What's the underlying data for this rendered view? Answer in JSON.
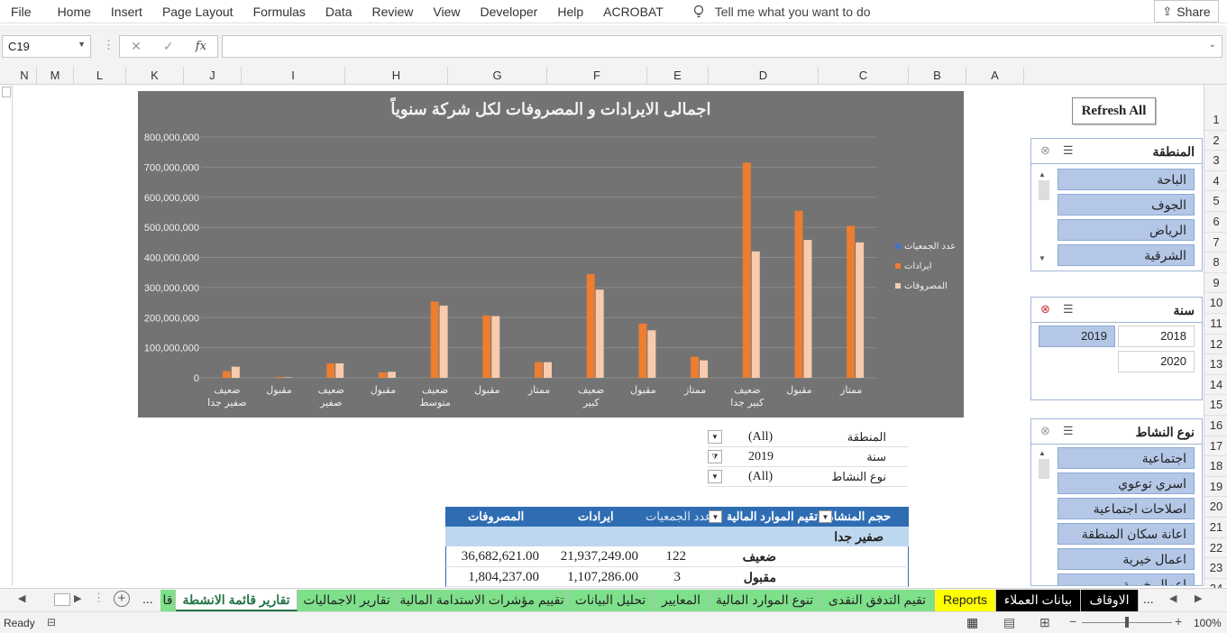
{
  "ribbon": {
    "tabs": [
      "File",
      "Home",
      "Insert",
      "Page Layout",
      "Formulas",
      "Data",
      "Review",
      "View",
      "Developer",
      "Help",
      "ACROBAT"
    ],
    "tell_me": "Tell me what you want to do",
    "share": "Share"
  },
  "formula_bar": {
    "name_box": "C19",
    "fx": "fx",
    "content": ""
  },
  "columns": [
    "N",
    "M",
    "L",
    "K",
    "J",
    "I",
    "H",
    "G",
    "F",
    "E",
    "D",
    "C",
    "B",
    "A"
  ],
  "rows": [
    "1",
    "2",
    "3",
    "4",
    "5",
    "6",
    "7",
    "8",
    "9",
    "10",
    "11",
    "12",
    "13",
    "14",
    "15",
    "16",
    "17",
    "18",
    "19",
    "20",
    "21",
    "22",
    "23",
    "24"
  ],
  "refresh_button": "Refresh All",
  "slicers": {
    "region": {
      "title": "المنطقة",
      "items": [
        "الباحة",
        "الجوف",
        "الرياض",
        "الشرقية"
      ]
    },
    "year": {
      "title": "سنة",
      "items": [
        {
          "label": "2019",
          "selected": true
        },
        {
          "label": "2018",
          "selected": false
        },
        {
          "label": "2020",
          "selected": false
        }
      ]
    },
    "activity": {
      "title": "نوع النشاط",
      "items": [
        "اجتماعية",
        "اسري توعوي",
        "اصلاحات اجتماعية",
        "اعانة سكان المنطقة",
        "اعمال خيرية",
        "اعمال خيرية"
      ]
    }
  },
  "filters": [
    {
      "label": "المنطقة",
      "value": "(All)"
    },
    {
      "label": "سنة",
      "value": "2019"
    },
    {
      "label": "نوع النشاط",
      "value": "(All)"
    }
  ],
  "pivot": {
    "headers": {
      "size": "حجم المنشاة",
      "rating": "تقيم الموارد المالية",
      "count": "عدد الجمعيات",
      "revenue": "ايرادات",
      "expenses": "المصروفات"
    },
    "group": "صفير جدا",
    "rows": [
      {
        "label": "ضعيف",
        "count": "122",
        "revenue": "21,937,249.00",
        "expenses": "36,682,621.00"
      },
      {
        "label": "مقبول",
        "count": "3",
        "revenue": "1,107,286.00",
        "expenses": "1,804,237.00"
      }
    ]
  },
  "sheet_tabs": [
    {
      "label": "قا",
      "color": "#7ee08a"
    },
    {
      "label": "تقارير قائمة الانشطة",
      "color": "#ffffff",
      "active": true
    },
    {
      "label": "تقارير الاجماليات",
      "color": "#7ee08a"
    },
    {
      "label": "تقييم مؤشرات الاستدامة المالية",
      "color": "#7ee08a"
    },
    {
      "label": "تحليل البيانات",
      "color": "#7ee08a"
    },
    {
      "label": "المعايير",
      "color": "#7ee08a"
    },
    {
      "label": "تنوع الموارد المالية",
      "color": "#7ee08a"
    },
    {
      "label": "تقيم التدفق النقدى",
      "color": "#7ee08a"
    },
    {
      "label": "Reports",
      "color": "#ffff00"
    },
    {
      "label": "بيانات العملاء",
      "color": "#000000"
    },
    {
      "label": "الاوقاف",
      "color": "#000000"
    }
  ],
  "tab_ellipsis": "...",
  "status": {
    "ready": "Ready",
    "zoom": "100%"
  },
  "chart_data": {
    "type": "bar",
    "title": "اجمالى الايرادات و المصروفات لكل شركة سنوياً",
    "ylim": [
      0,
      800000000
    ],
    "yticks": [
      "0",
      "100,000,000",
      "200,000,000",
      "300,000,000",
      "400,000,000",
      "500,000,000",
      "600,000,000",
      "700,000,000",
      "800,000,000"
    ],
    "categories": [
      [
        "ممتاز"
      ],
      [
        "مقبول"
      ],
      [
        "ضعيف",
        "كبير جدا"
      ],
      [
        "ممتاز"
      ],
      [
        "مقبول"
      ],
      [
        "ضعيف",
        "كبير"
      ],
      [
        "ممتاز"
      ],
      [
        "مقبول"
      ],
      [
        "ضعيف",
        "متوسط"
      ],
      [
        "مقبول"
      ],
      [
        "ضعيف",
        "صفير"
      ],
      [
        "مقبول"
      ],
      [
        "ضعيف",
        "صفير جدا"
      ]
    ],
    "legend_position": "right",
    "series": [
      {
        "name": "عدد الجمعيات",
        "color": "#4472c4",
        "values": [
          5,
          4,
          12,
          3,
          6,
          14,
          2,
          1,
          5,
          1,
          8,
          3,
          122
        ]
      },
      {
        "name": "ايرادات",
        "color": "#ed7d31",
        "values": [
          505000000,
          555000000,
          715000000,
          70000000,
          180000000,
          345000000,
          52000000,
          207000000,
          253000000,
          18000000,
          48000000,
          3000000,
          22000000
        ]
      },
      {
        "name": "المصروفات",
        "color": "#f8cbad",
        "values": [
          450000000,
          458000000,
          420000000,
          58000000,
          158000000,
          293000000,
          52000000,
          205000000,
          240000000,
          20000000,
          48000000,
          2000000,
          37000000
        ]
      }
    ]
  }
}
